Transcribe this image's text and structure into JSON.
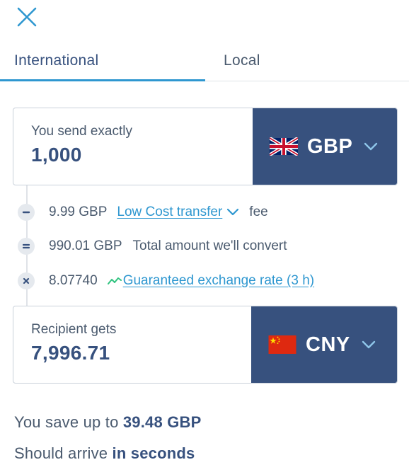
{
  "tabs": [
    {
      "label": "International",
      "active": true
    },
    {
      "label": "Local",
      "active": false
    }
  ],
  "send": {
    "label": "You send exactly",
    "amount": "1,000",
    "currency": "GBP",
    "flag": "uk-flag-icon"
  },
  "breakdown": {
    "fee": {
      "operator": "minus-icon",
      "amount": "9.99 GBP",
      "link": "Low Cost transfer",
      "suffix": "fee"
    },
    "convert": {
      "operator": "equals-icon",
      "amount": "990.01 GBP",
      "text": "Total amount we'll convert"
    },
    "rate": {
      "operator": "multiply-icon",
      "amount": "8.07740",
      "link": "Guaranteed exchange rate (3 h)"
    }
  },
  "receive": {
    "label": "Recipient gets",
    "amount": "7,996.71",
    "currency": "CNY",
    "flag": "china-flag-icon"
  },
  "savings": {
    "prefix": "You save up to",
    "amount": "39.48 GBP"
  },
  "arrival": {
    "prefix": "Should arrive",
    "value": "in seconds"
  },
  "colors": {
    "brand_navy": "#37517e",
    "accent_blue": "#2e97d0",
    "text_gray": "#4a5a6e"
  }
}
